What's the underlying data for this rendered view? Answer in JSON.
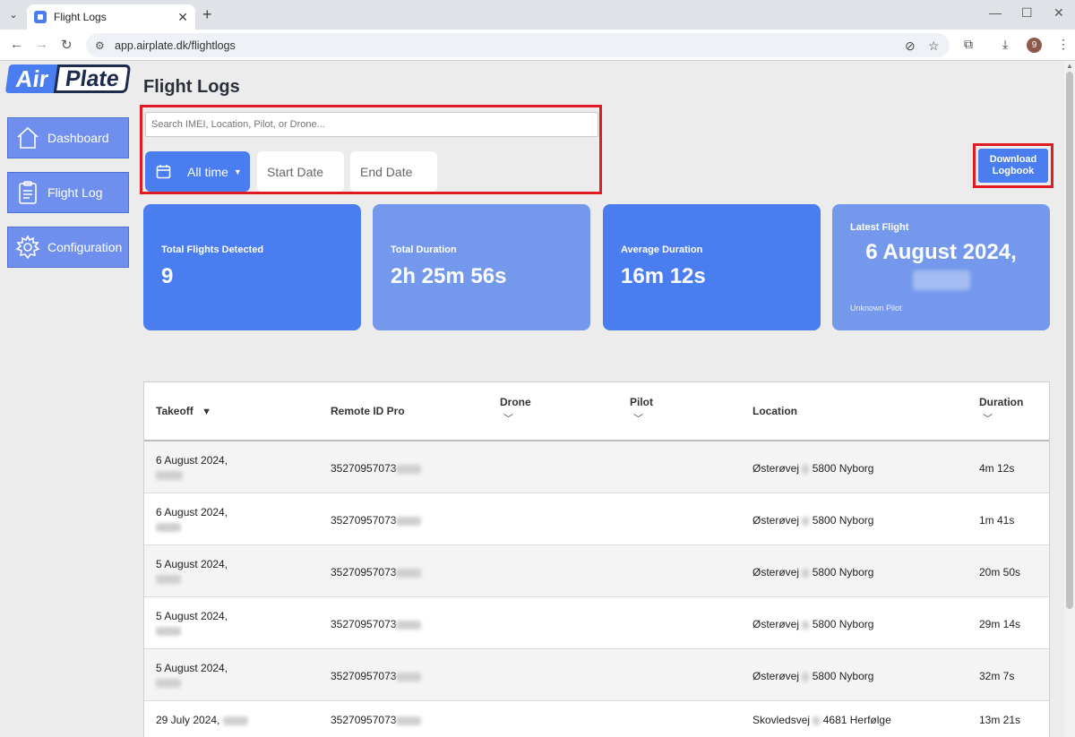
{
  "browser": {
    "tab_title": "Flight Logs",
    "url": "app.airplate.dk/flightlogs",
    "profile_initial": "9"
  },
  "logo": {
    "part1": "Air",
    "part2": "Plate"
  },
  "sidebar": {
    "items": [
      {
        "label": "Dashboard",
        "icon": "home-icon"
      },
      {
        "label": "Flight Log",
        "icon": "clipboard-icon"
      },
      {
        "label": "Configuration",
        "icon": "gear-icon"
      }
    ]
  },
  "header": {
    "title": "Flight Logs"
  },
  "filters": {
    "search_placeholder": "Search IMEI, Location, Pilot, or Drone...",
    "range_label": "All time",
    "start_placeholder": "Start Date",
    "end_placeholder": "End Date"
  },
  "download": {
    "line1": "Download",
    "line2": "Logbook"
  },
  "stats": {
    "total_flights": {
      "label": "Total Flights Detected",
      "value": "9"
    },
    "total_duration": {
      "label": "Total Duration",
      "value": "2h 25m 56s"
    },
    "average_duration": {
      "label": "Average Duration",
      "value": "16m 12s"
    },
    "latest": {
      "label": "Latest Flight",
      "value": "6 August 2024,",
      "pilot": "Unknown Pilot"
    }
  },
  "colors": {
    "accent": "#4a7df0",
    "card_light": "#7499ec",
    "highlight": "#e01b24"
  },
  "table": {
    "headers": {
      "takeoff": "Takeoff",
      "remote_id": "Remote ID Pro",
      "drone": "Drone",
      "pilot": "Pilot",
      "location": "Location",
      "duration": "Duration"
    },
    "rows": [
      {
        "date": "6 August 2024,",
        "remote_id": "35270957073",
        "street": "Østerøvej",
        "city": "5800 Nyborg",
        "duration": "4m 12s"
      },
      {
        "date": "6 August 2024,",
        "remote_id": "35270957073",
        "street": "Østerøvej",
        "city": "5800 Nyborg",
        "duration": "1m 41s"
      },
      {
        "date": "5 August 2024,",
        "remote_id": "35270957073",
        "street": "Østerøvej",
        "city": "5800 Nyborg",
        "duration": "20m 50s"
      },
      {
        "date": "5 August 2024,",
        "remote_id": "35270957073",
        "street": "Østerøvej",
        "city": "5800 Nyborg",
        "duration": "29m 14s"
      },
      {
        "date": "5 August 2024,",
        "remote_id": "35270957073",
        "street": "Østerøvej",
        "city": "5800 Nyborg",
        "duration": "32m 7s"
      },
      {
        "date": "29 July 2024,",
        "remote_id": "35270957073",
        "street": "Skovledsvej",
        "city": "4681 Herfølge",
        "duration": "13m 21s"
      }
    ]
  }
}
